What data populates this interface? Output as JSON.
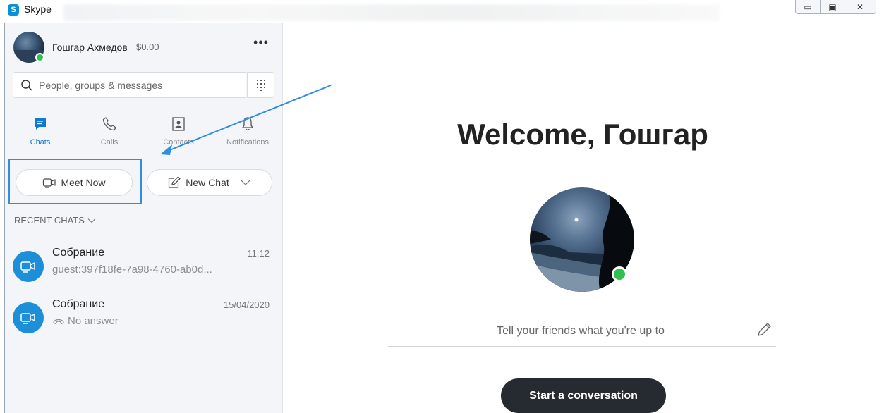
{
  "window": {
    "title": "Skype",
    "logo_letter": "S",
    "controls": {
      "minimize": "▭",
      "maximize": "▣",
      "close": "✕"
    }
  },
  "profile": {
    "name": "Гошгар Ахмедов",
    "balance": "$0.00",
    "more_label": "•••",
    "status_color": "#2fc04d"
  },
  "search": {
    "placeholder": "People, groups & messages",
    "value": ""
  },
  "tabs": [
    {
      "label": "Chats",
      "icon": "chat-icon",
      "active": true
    },
    {
      "label": "Calls",
      "icon": "phone-icon",
      "active": false
    },
    {
      "label": "Contacts",
      "icon": "contacts-icon",
      "active": false
    },
    {
      "label": "Notifications",
      "icon": "bell-icon",
      "active": false
    }
  ],
  "actions": {
    "meet_now": "Meet Now",
    "new_chat": "New Chat"
  },
  "recent_chats": {
    "header": "RECENT CHATS",
    "items": [
      {
        "name": "Собрание",
        "time": "11:12",
        "preview": "guest:397f18fe-7a98-4760-ab0d..."
      },
      {
        "name": "Собрание",
        "time": "15/04/2020",
        "preview": "No answer"
      }
    ]
  },
  "main": {
    "welcome": "Welcome, Гошгар",
    "mood_placeholder": "Tell your friends what you're up to",
    "start_button": "Start a conversation"
  },
  "colors": {
    "accent": "#0f78d4",
    "chat_avatar": "#1d8fd8",
    "highlight": "#2f8ee0",
    "start_button_bg": "#262a31"
  }
}
